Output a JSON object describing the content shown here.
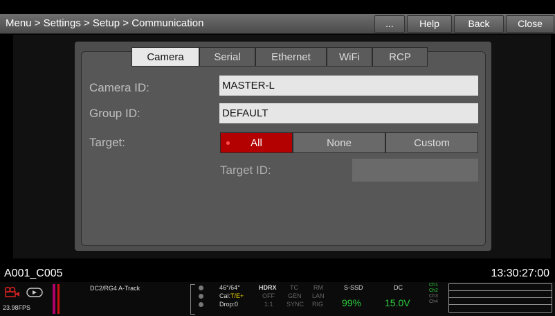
{
  "titlebar": {
    "breadcrumb": "Menu > Settings > Setup > Communication",
    "buttons": [
      "...",
      "Help",
      "Back",
      "Close"
    ]
  },
  "tabs": [
    "Camera",
    "Serial",
    "Ethernet",
    "WiFi",
    "RCP"
  ],
  "active_tab": "Camera",
  "form": {
    "camera_id_label": "Camera ID:",
    "camera_id_value": "MASTER-L",
    "group_id_label": "Group ID:",
    "group_id_value": "DEFAULT",
    "target_label": "Target:",
    "target_options": [
      "All",
      "None",
      "Custom"
    ],
    "target_selected": "All",
    "target_id_label": "Target ID:",
    "target_id_value": ""
  },
  "clip_name": "A001_C005",
  "timecode": "13:30:27:00",
  "status": {
    "fps": "23.98FPS",
    "dc_track": "DC2/RG4 A-Track",
    "temp": "46°/64°",
    "cal_prefix": "Cal:",
    "cal_value": "T/E+",
    "drop": "Drop:0",
    "hdrx": "HDRX",
    "hdrx_state": "OFF",
    "hdrx_ratio": "1:1",
    "tc": "TC",
    "tc_gen": "GEN",
    "tc_sync": "SYNC",
    "rm": "RM",
    "rm_lan": "LAN",
    "rm_rig": "RIG",
    "media_label": "S-SSD",
    "media_value": "99%",
    "power_label": "DC",
    "power_value": "15.0V",
    "channels": [
      "Ch1",
      "Ch2",
      "Ch3",
      "Ch4"
    ]
  },
  "colors": {
    "accent_red": "#b30000",
    "status_green": "#2ccd3c"
  }
}
